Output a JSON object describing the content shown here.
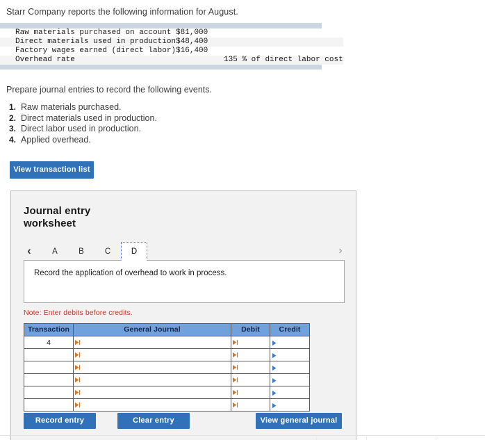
{
  "intro": {
    "text": "Starr Company reports the following information for August."
  },
  "fact_table": {
    "rows": [
      {
        "label": "Raw materials purchased on account",
        "value": "$81,000",
        "indent": false
      },
      {
        "label": "Direct materials used in production",
        "value": "$48,400",
        "indent": false
      },
      {
        "label": "Factory wages earned (direct labor)",
        "value": "$16,400",
        "indent": false
      },
      {
        "label": "Overhead rate",
        "value": "135 % of direct labor cost",
        "indent": true
      }
    ]
  },
  "prepare": {
    "text": "Prepare journal entries to record the following events."
  },
  "events": [
    {
      "num": "1.",
      "label": "Raw materials purchased."
    },
    {
      "num": "2.",
      "label": "Direct materials used in production."
    },
    {
      "num": "3.",
      "label": "Direct labor used in production."
    },
    {
      "num": "4.",
      "label": "Applied overhead."
    }
  ],
  "buttons": {
    "view_transaction_list": "View transaction list",
    "record_entry": "Record entry",
    "clear_entry": "Clear entry",
    "view_general_journal": "View general journal"
  },
  "panel": {
    "title": "Journal entry worksheet",
    "tabs": [
      {
        "label": "A",
        "active": false
      },
      {
        "label": "B",
        "active": false
      },
      {
        "label": "C",
        "active": false
      },
      {
        "label": "D",
        "active": true
      }
    ],
    "nav_prev_icon": "‹",
    "nav_next_icon": "›",
    "description": "Record the application of overhead to work in process.",
    "note": "Note: Enter debits before credits."
  },
  "journal_table": {
    "headers": [
      "Transaction",
      "General Journal",
      "Debit",
      "Credit"
    ],
    "rows": [
      {
        "transaction": "4",
        "general_journal": "",
        "debit": "",
        "credit": ""
      },
      {
        "transaction": "",
        "general_journal": "",
        "debit": "",
        "credit": ""
      },
      {
        "transaction": "",
        "general_journal": "",
        "debit": "",
        "credit": ""
      },
      {
        "transaction": "",
        "general_journal": "",
        "debit": "",
        "credit": ""
      },
      {
        "transaction": "",
        "general_journal": "",
        "debit": "",
        "credit": ""
      },
      {
        "transaction": "",
        "general_journal": "",
        "debit": "",
        "credit": ""
      }
    ]
  },
  "colors": {
    "button_blue": "#3071b8",
    "table_header_blue": "#6fa1dd",
    "note_red": "#c0392b",
    "fact_band": "#ccd6e2",
    "marker_orange": "#d2762a",
    "marker_blue": "#3c78c8"
  }
}
